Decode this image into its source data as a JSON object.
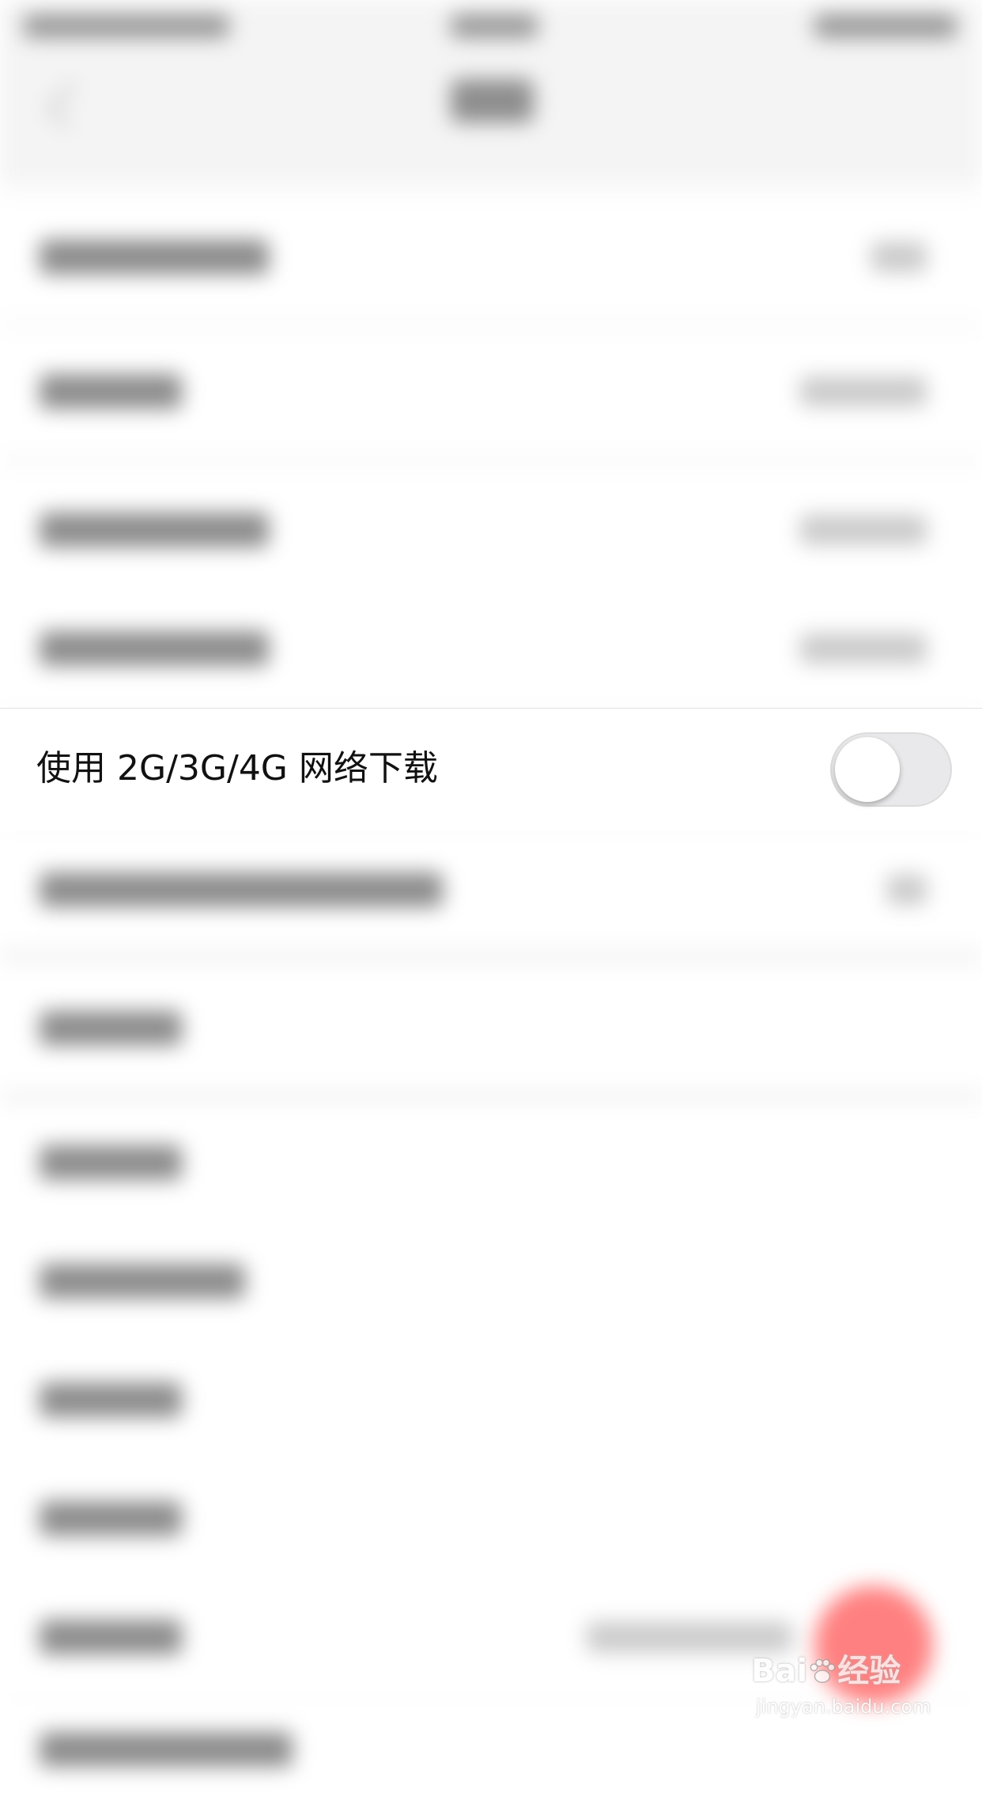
{
  "settings": {
    "cellular_download": {
      "label": "使用 2G/3G/4G 网络下载",
      "enabled": false
    }
  },
  "icons": {
    "back": "chevron-left-icon"
  },
  "colors": {
    "toggle_off_track": "#e9e9eb",
    "toggle_knob": "#ffffff",
    "floating_button": "#ff8080",
    "background": "#fbfbfb"
  },
  "watermark": {
    "brand_left": "Bai",
    "brand_right": "经验",
    "url": "jingyan.baidu.com"
  }
}
